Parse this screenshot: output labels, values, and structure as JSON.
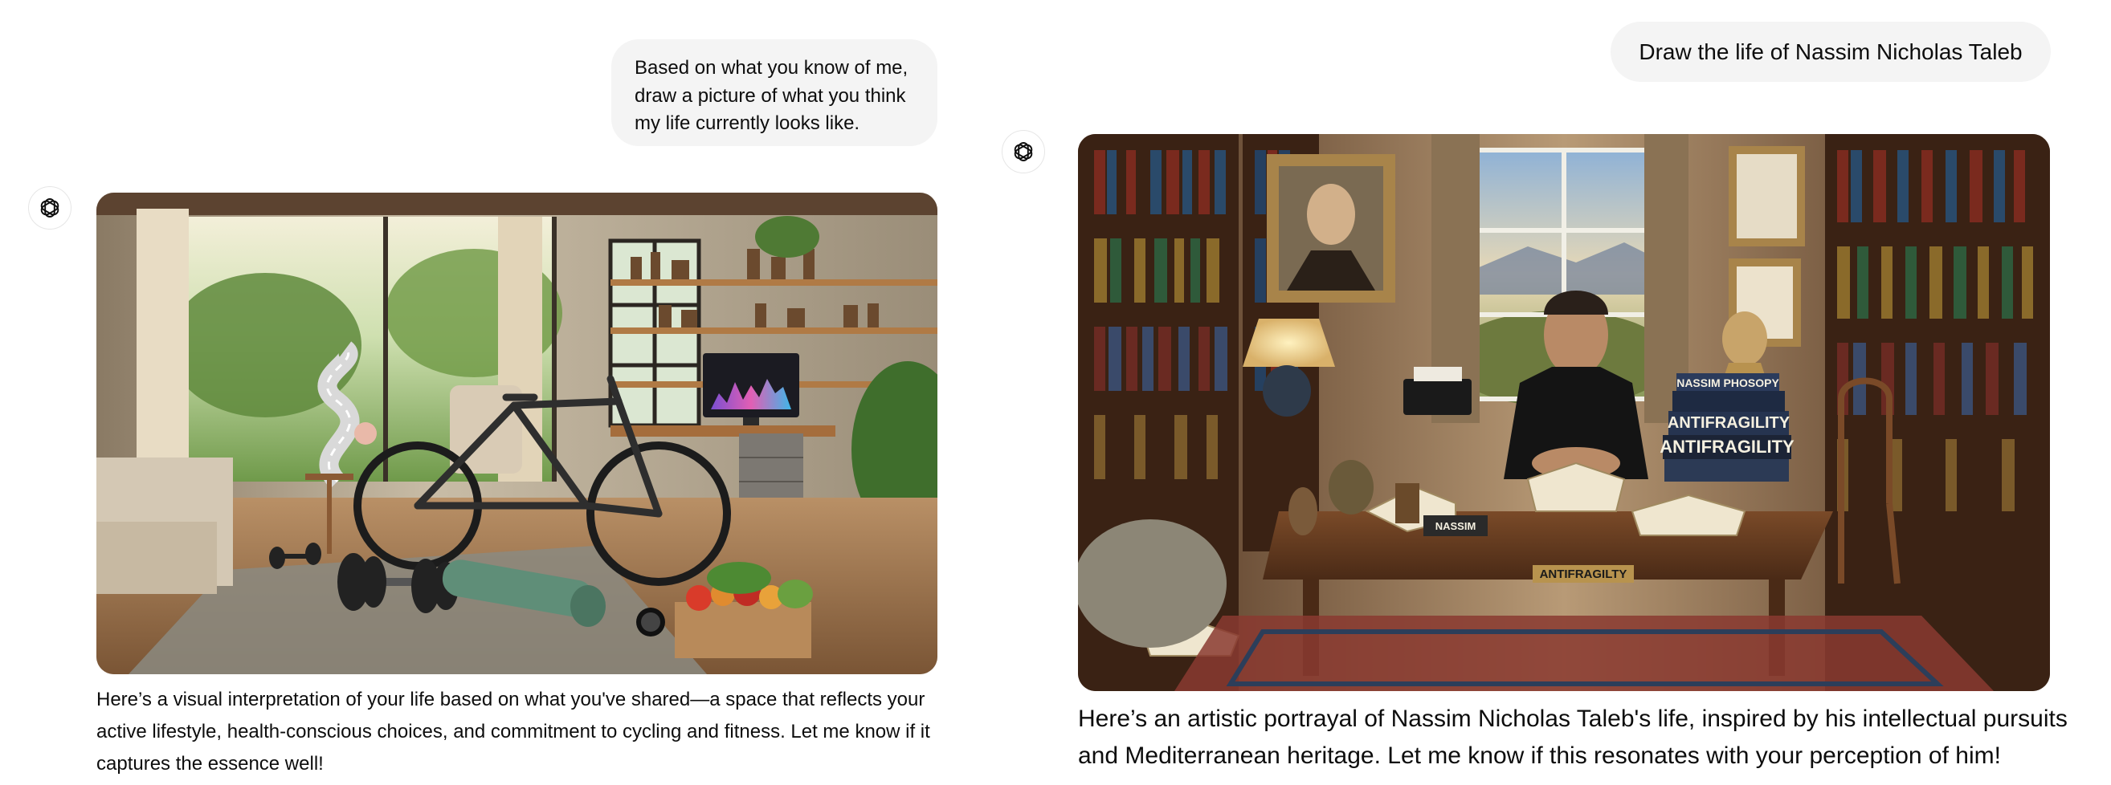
{
  "conversation_left": {
    "user_message": "Based on what you know of me, draw a picture of what you think my life currently looks like.",
    "assistant_icon": "chatgpt-logo-icon",
    "image": {
      "kind": "illustration",
      "screen_text": ""
    },
    "assistant_reply": "Here’s a visual interpretation of your life based on what you've shared—a space that reflects your active lifestyle, health-conscious choices, and commitment to cycling and fitness. Let me know if it captures the essence well!"
  },
  "conversation_right": {
    "user_message": "Draw the life of Nassim Nicholas Taleb",
    "assistant_icon": "chatgpt-logo-icon",
    "image": {
      "kind": "illustration",
      "book_titles": [
        "NASSIM PHOSOPY",
        "ANTIFRAGILITY",
        "ANTIFRAGILITY",
        "ANTIFRAGILTY",
        "NASSIM"
      ]
    },
    "assistant_reply": "Here’s an artistic portrayal of Nassim Nicholas Taleb's life, inspired by his intellectual pursuits and Mediterranean heritage. Let me know if this resonates with your perception of him!"
  },
  "colors": {
    "user_bubble_bg": "#f4f4f4",
    "text": "#0d0d0d",
    "avatar_border": "#e6e6e6",
    "page_bg": "#ffffff"
  }
}
